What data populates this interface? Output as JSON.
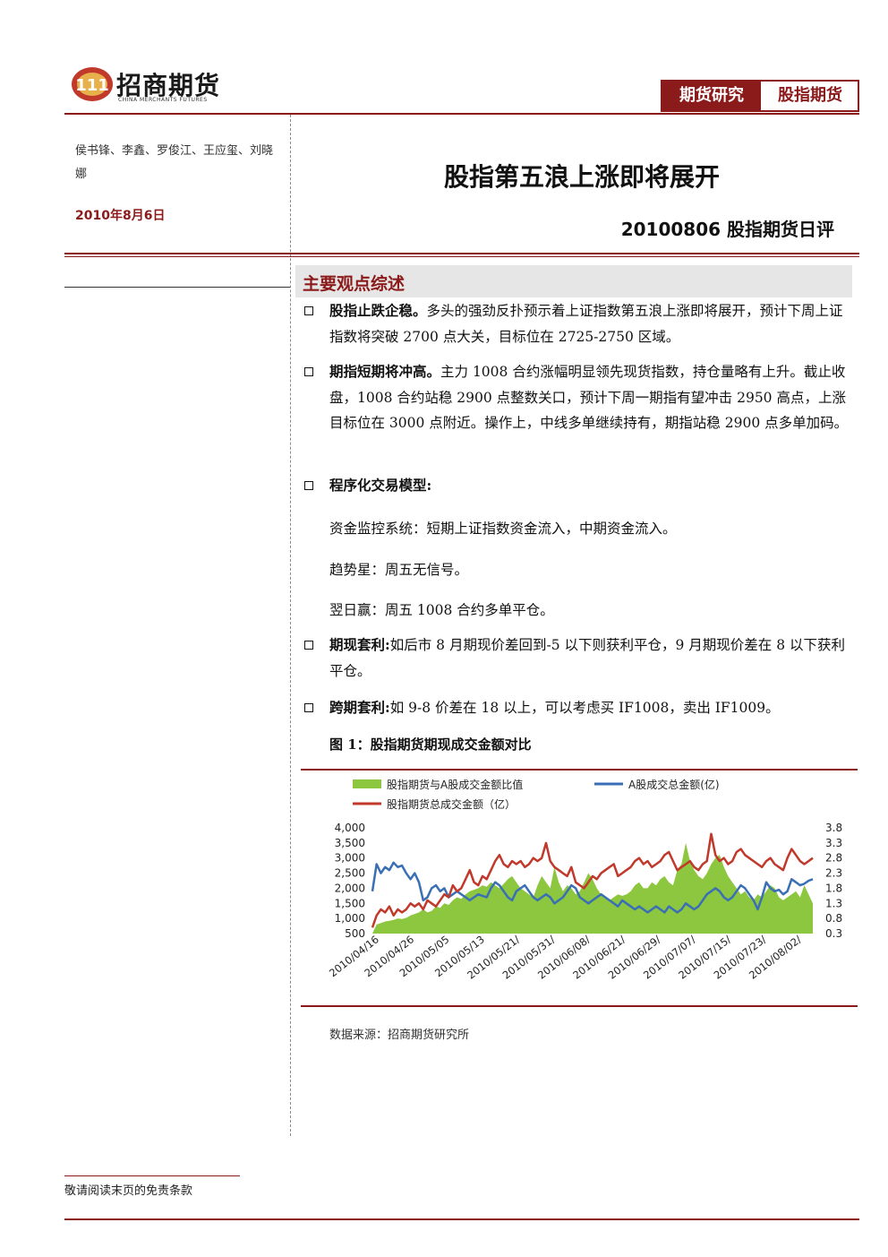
{
  "header": {
    "logo_cn": "招商期货",
    "logo_en": "CHINA MERCHANTS FUTURES",
    "tag_research": "期货研究",
    "tag_category": "股指期货"
  },
  "meta": {
    "authors": "侯书锋、李鑫、罗俊江、王应玺、刘晓娜",
    "date": "2010年8月6日"
  },
  "report": {
    "title": "股指第五浪上涨即将展开",
    "subtitle": "20100806 股指期货日评"
  },
  "section": {
    "title": "主要观点综述",
    "items": [
      {
        "lead": "股指止跌企稳。",
        "text": "多头的强劲反扑预示着上证指数第五浪上涨即将展开，预计下周上证指数将突破 2700 点大关，目标位在 2725-2750 区域。"
      },
      {
        "lead": "期指短期将冲高。",
        "text": "主力 1008 合约涨幅明显领先现货指数，持仓量略有上升。截止收盘，1008 合约站稳 2900 点整数关口，预计下周一期指有望冲击 2950 高点，上涨目标位在 3000 点附近。操作上，中线多单继续持有，期指站稳 2900 点多单加码。"
      },
      {
        "lead": "程序化交易模型:",
        "text": ""
      },
      {
        "lead": "期现套利:",
        "text": "如后市 8 月期现价差回到-5 以下则获利平仓，9 月期现价差在 8 以下获利平仓。"
      },
      {
        "lead": "跨期套利:",
        "text": "如 9-8 价差在 18 以上，可以考虑买 IF1008，卖出 IF1009。"
      }
    ],
    "model_lines": [
      "资金监控系统：短期上证指数资金流入，中期资金流入。",
      "趋势星：周五无信号。",
      "翌日赢：周五 1008 合约多单平仓。"
    ]
  },
  "figure": {
    "caption": "图 1：股指期货期现成交金额对比",
    "source": "数据来源：招商期货研究所"
  },
  "footer": {
    "notice": "敬请阅读末页的免责条款"
  },
  "colors": {
    "brand": "#8b1a1a",
    "ratio_fill": "#8dc63f",
    "a_share": "#3a6fb5",
    "futures": "#c0392b"
  },
  "chart_data": {
    "type": "area",
    "title": "",
    "xlabel": "",
    "ylabel": "",
    "ylim": [
      500,
      4000
    ],
    "y2lim": [
      0.3,
      3.8
    ],
    "yticks": [
      "4,000",
      "3,500",
      "3,000",
      "2,500",
      "2,000",
      "1,500",
      "1,000",
      "500"
    ],
    "y2ticks": [
      "3.8",
      "3.3",
      "2.8",
      "2.3",
      "1.8",
      "1.3",
      "0.8",
      "0.3"
    ],
    "xticks": [
      "2010/04/16",
      "2010/04/26",
      "2010/05/05",
      "2010/05/13",
      "2010/05/21/",
      "2010/05/31/",
      "2010/06/08/",
      "2010/06/21/",
      "2010/06/29/",
      "2010/07/07/",
      "2010/07/15/",
      "2010/07/23/",
      "2010/08/02/"
    ],
    "legend_placement": "top",
    "series": [
      {
        "name": "股指期货与A股成交金额比值",
        "axis": "right",
        "kind": "area",
        "values": [
          0.3,
          0.6,
          0.65,
          0.7,
          0.72,
          0.75,
          0.8,
          0.78,
          0.82,
          0.9,
          0.95,
          1.0,
          1.1,
          1.0,
          1.05,
          1.2,
          1.15,
          1.3,
          1.25,
          1.4,
          1.5,
          1.45,
          1.6,
          1.7,
          1.75,
          1.8,
          1.9,
          1.85,
          2.0,
          1.9,
          1.8,
          1.95,
          2.1,
          2.2,
          2.0,
          1.8,
          1.7,
          1.6,
          1.5,
          1.9,
          2.2,
          2.0,
          1.8,
          2.5,
          2.0,
          1.7,
          1.9,
          1.8,
          1.6,
          1.7,
          2.0,
          2.3,
          2.1,
          1.8,
          1.6,
          1.5,
          1.4,
          1.5,
          1.6,
          1.55,
          1.6,
          1.7,
          1.9,
          2.0,
          1.8,
          1.8,
          2.0,
          1.9,
          2.1,
          2.2,
          2.0,
          1.9,
          2.4,
          2.6,
          3.3,
          2.7,
          2.4,
          2.2,
          2.1,
          2.3,
          2.6,
          2.8,
          2.9,
          2.5,
          2.2,
          2.0,
          1.8,
          1.6,
          1.7,
          1.5,
          1.4,
          1.6,
          1.5,
          1.7,
          1.9,
          1.8,
          1.5,
          1.4,
          1.5,
          1.6,
          1.7,
          1.5,
          1.9,
          1.6,
          1.3
        ]
      },
      {
        "name": "A股成交总金额(亿)",
        "axis": "left",
        "kind": "line",
        "values": [
          1900,
          2800,
          2500,
          2700,
          2600,
          2850,
          2700,
          2750,
          2500,
          2300,
          2500,
          2200,
          1600,
          1700,
          2000,
          2100,
          1900,
          2000,
          1700,
          1800,
          1900,
          1800,
          1700,
          1600,
          1700,
          1800,
          1750,
          1700,
          2000,
          2200,
          2100,
          1900,
          1700,
          1600,
          1900,
          2000,
          2100,
          1900,
          1700,
          1600,
          1700,
          1800,
          1700,
          1500,
          1600,
          1700,
          1900,
          2100,
          2000,
          1700,
          1600,
          1500,
          1600,
          1700,
          1800,
          1700,
          1600,
          1500,
          1400,
          1600,
          1500,
          1400,
          1300,
          1400,
          1300,
          1200,
          1300,
          1400,
          1300,
          1200,
          1400,
          1300,
          1200,
          1300,
          1500,
          1400,
          1300,
          1400,
          1600,
          1800,
          1900,
          2000,
          1900,
          1700,
          1600,
          1700,
          1900,
          2100,
          2000,
          1800,
          1600,
          1300,
          1700,
          2200,
          2000,
          1900,
          1950,
          1800,
          1900,
          2300,
          2200,
          2100,
          2150,
          2250,
          2300
        ]
      },
      {
        "name": "股指期货总成交金额（亿）",
        "axis": "left",
        "kind": "line",
        "values": [
          700,
          1100,
          1300,
          1200,
          1400,
          1100,
          1300,
          1200,
          1300,
          1500,
          1400,
          1500,
          1300,
          1600,
          1500,
          1400,
          1600,
          1800,
          1700,
          2100,
          1900,
          2000,
          2300,
          2600,
          2200,
          2100,
          2400,
          2300,
          2600,
          2900,
          3100,
          2800,
          2700,
          2900,
          2800,
          2900,
          2700,
          2800,
          3000,
          2900,
          3000,
          3500,
          2900,
          2700,
          2600,
          2500,
          2400,
          2700,
          2200,
          2100,
          2000,
          2200,
          2400,
          2300,
          2500,
          2600,
          2700,
          2800,
          2400,
          2500,
          2600,
          2700,
          2900,
          3000,
          2800,
          2900,
          2700,
          2800,
          2900,
          3100,
          3200,
          2900,
          2600,
          2700,
          2800,
          2900,
          2700,
          2600,
          2800,
          2900,
          3800,
          3100,
          2900,
          3000,
          2800,
          2900,
          3200,
          3300,
          3100,
          3000,
          2900,
          2800,
          2700,
          2900,
          3000,
          2800,
          2700,
          2600,
          3000,
          3300,
          3100,
          2900,
          2800,
          2900,
          3000
        ]
      }
    ]
  }
}
